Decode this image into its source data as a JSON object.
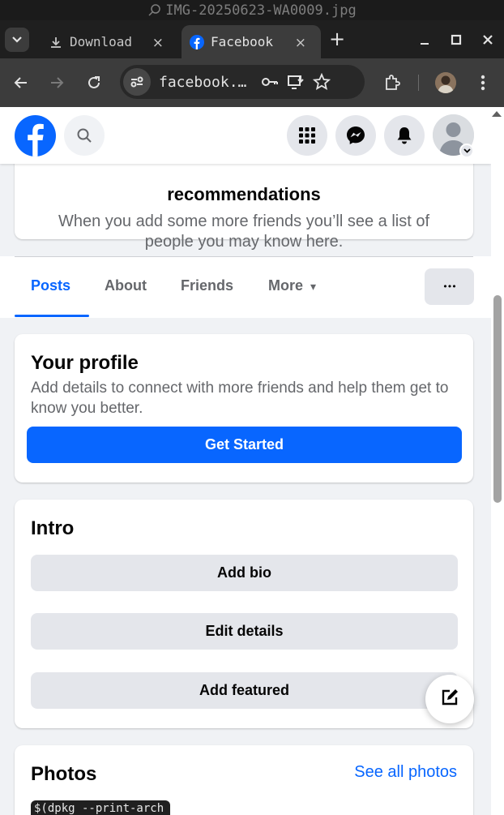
{
  "os": {
    "window_title": "IMG-20250623-WA0009.jpg"
  },
  "browser": {
    "tabs": [
      {
        "label": "Download",
        "active": false
      },
      {
        "label": "Facebook",
        "active": true
      }
    ],
    "new_tab_label": "+",
    "close_glyph": "×",
    "url": "facebook.com",
    "url_display": "facebook.…"
  },
  "facebook": {
    "recommendations": {
      "title": "recommendations",
      "text": "When you add some more friends you’ll see a list of people you may know here."
    },
    "profile_tabs": {
      "posts": "Posts",
      "about": "About",
      "friends": "Friends",
      "more": "More",
      "more_caret": "▾",
      "overflow": "•••",
      "active": "Posts"
    },
    "your_profile": {
      "title": "Your profile",
      "description": "Add details to connect with more friends and help them get to know you better.",
      "cta": "Get Started"
    },
    "intro": {
      "title": "Intro",
      "add_bio": "Add bio",
      "edit_details": "Edit details",
      "add_featured": "Add featured"
    },
    "photos": {
      "title": "Photos",
      "see_all": "See all photos",
      "thumb_text": "$(dpkg --print-arch"
    }
  },
  "colors": {
    "fb_blue": "#0866ff",
    "page_bg": "#f0f2f5",
    "grey_button": "#e4e6eb",
    "secondary_text": "#65676b",
    "browser_dark": "#3c3c3c"
  },
  "icons": [
    "search-icon",
    "chevron-down-icon",
    "download-icon",
    "facebook-icon",
    "close-icon",
    "plus-icon",
    "minimize-icon",
    "maximize-icon",
    "back-icon",
    "forward-icon",
    "reload-icon",
    "site-info-icon",
    "password-key-icon",
    "install-app-icon",
    "bookmark-star-icon",
    "extensions-icon",
    "kebab-menu-icon",
    "grid-menu-icon",
    "messenger-icon",
    "bell-icon",
    "avatar-icon",
    "edit-icon"
  ]
}
